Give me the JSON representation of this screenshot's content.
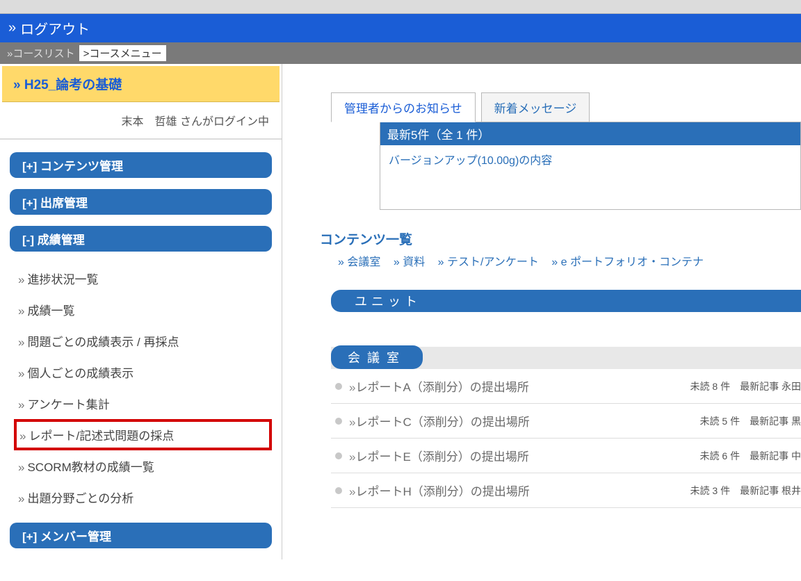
{
  "header": {
    "logout": "ログアウト"
  },
  "breadcrumb": {
    "course_list": "コースリスト",
    "course_menu": "コースメニュー"
  },
  "course": {
    "title": "H25_論考の基礎"
  },
  "user": {
    "login_status": "末本　哲雄 さんがログイン中"
  },
  "nav": {
    "groups": [
      {
        "label": "[+] コンテンツ管理",
        "expanded": false
      },
      {
        "label": "[+] 出席管理",
        "expanded": false
      },
      {
        "label": "[-] 成績管理",
        "expanded": true,
        "items": [
          "進捗状況一覧",
          "成績一覧",
          "問題ごとの成績表示 / 再採点",
          "個人ごとの成績表示",
          "アンケート集計",
          "レポート/記述式問題の採点",
          "SCORM教材の成績一覧",
          "出題分野ごとの分析"
        ],
        "highlighted_index": 5
      },
      {
        "label": "[+] メンバー管理",
        "expanded": false
      }
    ]
  },
  "tabs": {
    "active": "管理者からのお知らせ",
    "inactive": "新着メッセージ"
  },
  "notice": {
    "header": "最新5件（全 1 件）",
    "item": "バージョンアップ(10.00g)の内容"
  },
  "contents": {
    "title": "コンテンツ一覧",
    "links": [
      "会議室",
      "資料",
      "テスト/アンケート",
      "e ポートフォリオ・コンテナ"
    ]
  },
  "unit": {
    "label": "ユニット"
  },
  "bbs": {
    "label": "会議室",
    "items": [
      {
        "title": "レポートA（添削分）の提出場所",
        "meta": "未読 8 件　最新記事 永田"
      },
      {
        "title": "レポートC（添削分）の提出場所",
        "meta": "未読 5 件　最新記事 黒"
      },
      {
        "title": "レポートE（添削分）の提出場所",
        "meta": "未読 6 件　最新記事 中"
      },
      {
        "title": "レポートH（添削分）の提出場所",
        "meta": "未読 3 件　最新記事 根井"
      }
    ]
  }
}
